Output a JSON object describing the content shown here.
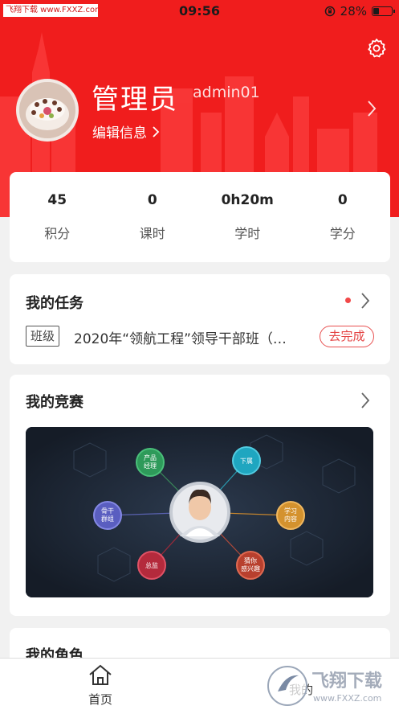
{
  "status_bar": {
    "watermark": "飞翔下载 www.FXXZ.com",
    "time": "09:56",
    "battery_percent": "28%",
    "battery_level": 0.28
  },
  "profile": {
    "name": "管理员",
    "user_id": "admin01",
    "edit_label": "编辑信息"
  },
  "stats": [
    {
      "value": "45",
      "label": "积分"
    },
    {
      "value": "0",
      "label": "课时"
    },
    {
      "value": "0h20m",
      "label": "学时"
    },
    {
      "value": "0",
      "label": "学分"
    }
  ],
  "tasks": {
    "title": "我的任务",
    "tag": "班级",
    "text": "2020年“领航工程”领导干部班（…",
    "action": "去完成"
  },
  "contest": {
    "title": "我的竞赛",
    "nodes": {
      "product_manager": "产品\n经理",
      "subordinate": "下属",
      "learning_content": "学习\n内容",
      "guess_interest": "猜你\n感兴趣",
      "director": "总监",
      "backbone": "骨干\n群组"
    }
  },
  "roles": {
    "title": "我的角色"
  },
  "nav": {
    "home": "首页",
    "mine": "我的",
    "watermark_logo": "飞翔下载",
    "watermark_url": "www.FXXZ.com"
  },
  "colors": {
    "brand_red": "#f01d1d",
    "action_red": "#e44444",
    "banner_dark": "#1d2634"
  }
}
